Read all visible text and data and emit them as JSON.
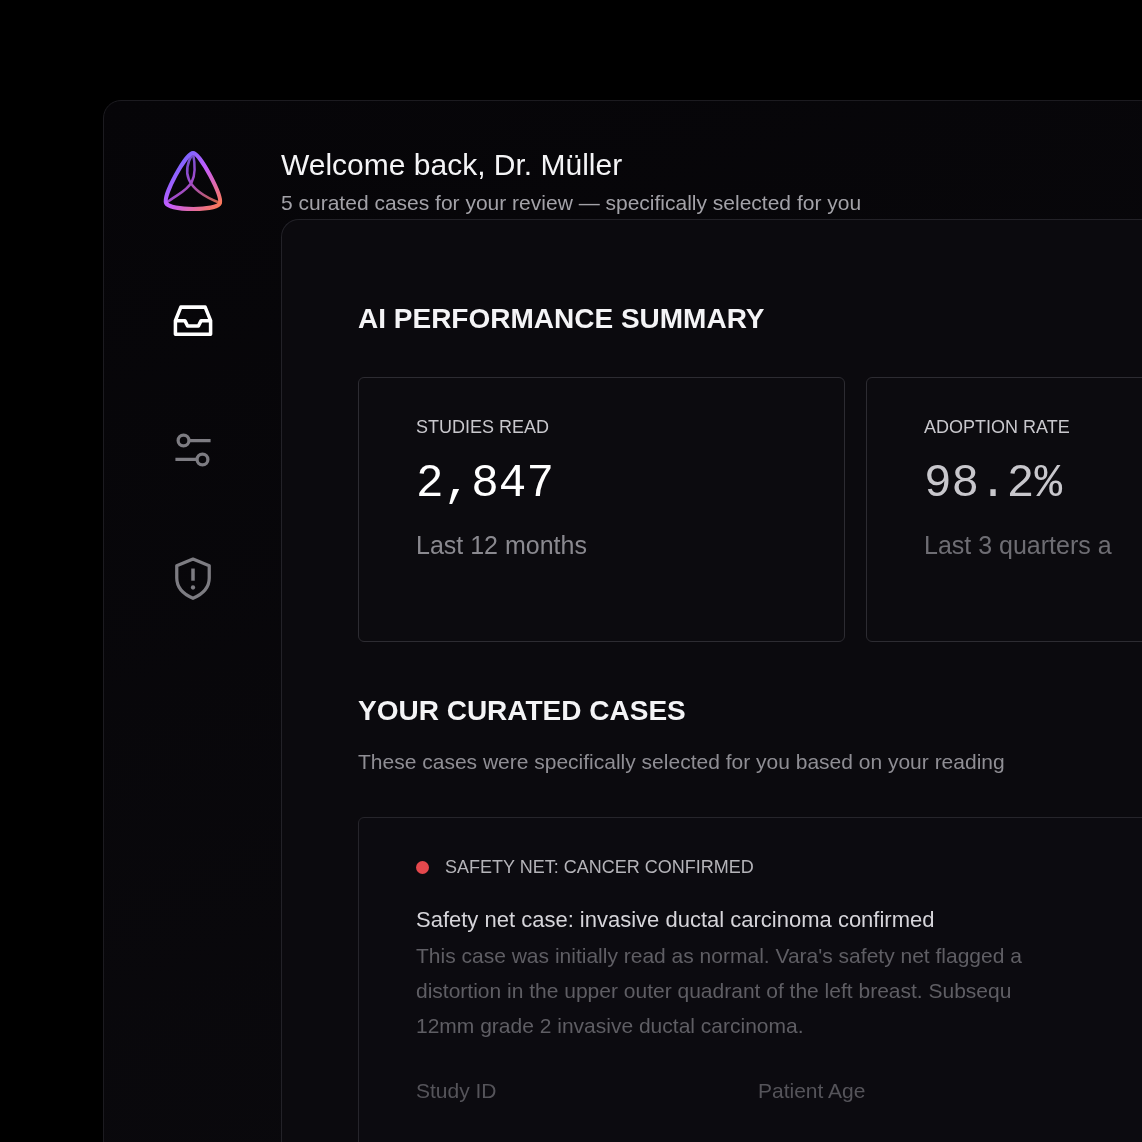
{
  "header": {
    "title": "Welcome back, Dr. Müller",
    "subtitle": "5 curated cases for your review — specifically selected for you"
  },
  "sidebar": {
    "items": [
      {
        "kind": "inbox",
        "selected": true
      },
      {
        "kind": "sliders",
        "selected": false
      },
      {
        "kind": "shield",
        "selected": false
      }
    ]
  },
  "summary": {
    "title": "AI PERFORMANCE SUMMARY",
    "stats": [
      {
        "label": "STUDIES READ",
        "value": "2,847",
        "caption": "Last 12 months"
      },
      {
        "label": "ADOPTION RATE",
        "value": "98.2%",
        "caption": "Last 3 quarters a"
      }
    ]
  },
  "curated": {
    "title": "YOUR CURATED CASES",
    "description": "These cases were specifically selected for you based on your reading",
    "cases": [
      {
        "tag": "SAFETY NET: CANCER CONFIRMED",
        "color": "#e5484d",
        "title": "Safety net case: invasive ductal carcinoma confirmed",
        "body": "This case was initially read as normal. Vara's safety net flagged a\ndistortion in the upper outer quadrant of the left breast. Subsequ\n12mm grade 2 invasive ductal carcinoma.",
        "fields": [
          "Study ID",
          "Patient Age"
        ]
      }
    ]
  }
}
